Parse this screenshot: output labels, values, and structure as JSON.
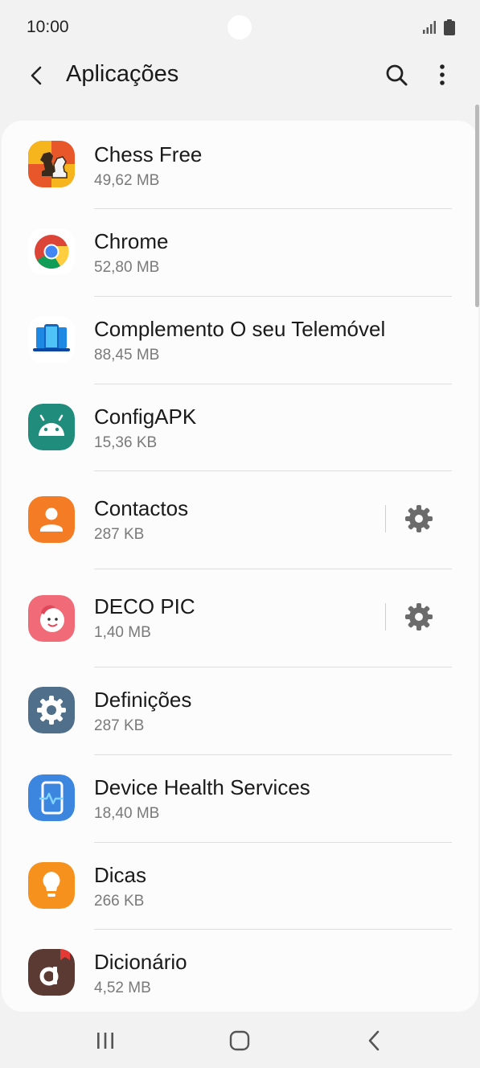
{
  "status_bar": {
    "time": "10:00"
  },
  "app_bar": {
    "title": "Aplicações"
  },
  "apps": [
    {
      "name": "Chess Free",
      "size": "49,62 MB",
      "icon": "chess-app-icon",
      "settings": false
    },
    {
      "name": "Chrome",
      "size": "52,80 MB",
      "icon": "chrome-icon",
      "settings": false
    },
    {
      "name": "Complemento O seu Telemóvel",
      "size": "88,45 MB",
      "icon": "link-to-windows-icon",
      "settings": false
    },
    {
      "name": "ConfigAPK",
      "size": "15,36 KB",
      "icon": "android-icon",
      "settings": false
    },
    {
      "name": "Contactos",
      "size": "287 KB",
      "icon": "contacts-icon",
      "settings": true
    },
    {
      "name": "DECO PIC",
      "size": "1,40 MB",
      "icon": "deco-pic-icon",
      "settings": true
    },
    {
      "name": "Definições",
      "size": "287 KB",
      "icon": "settings-app-icon",
      "settings": false
    },
    {
      "name": "Device Health Services",
      "size": "18,40 MB",
      "icon": "device-health-icon",
      "settings": false
    },
    {
      "name": "Dicas",
      "size": "266 KB",
      "icon": "tips-icon",
      "settings": false
    },
    {
      "name": "Dicionário",
      "size": "4,52 MB",
      "icon": "dictionary-icon",
      "settings": false
    }
  ],
  "colors": {
    "background": "#f2f2f2",
    "card": "#fcfcfc",
    "contacts": "#f47c25",
    "settings": "#4f6f8a",
    "device_health": "#3d86e0",
    "tips": "#f7911e",
    "android": "#1f8c7c"
  }
}
